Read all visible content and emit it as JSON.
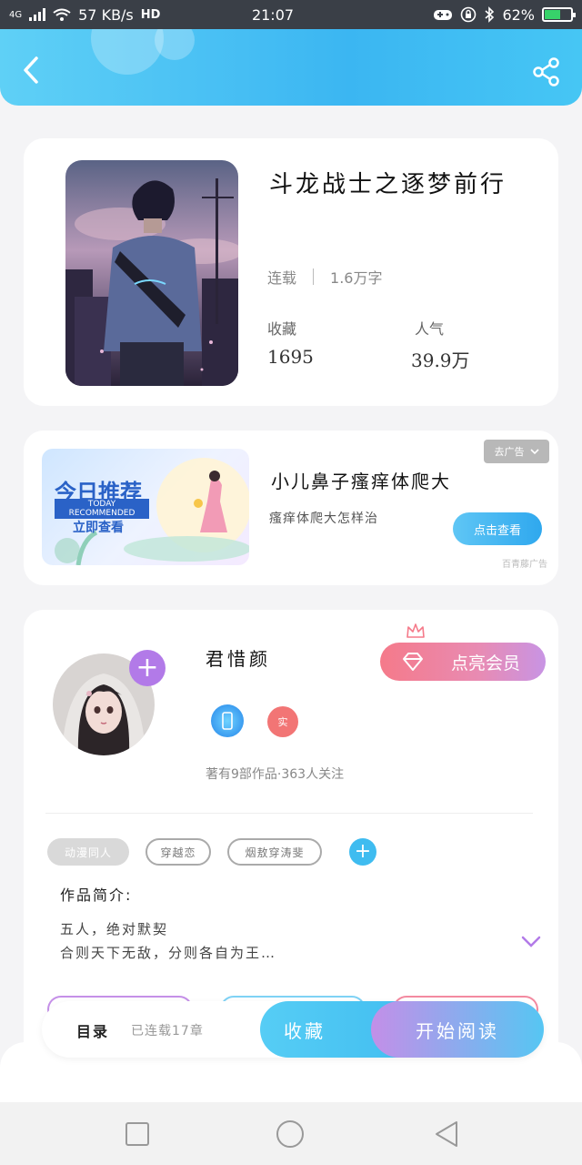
{
  "status": {
    "network": "4G",
    "speed": "57 KB/s",
    "hd": "HD",
    "time": "21:07",
    "battery": "62%",
    "battery_level": 0.62
  },
  "header": {
    "back_icon": "chevron-left-icon",
    "share_icon": "share-icon"
  },
  "book": {
    "title": "斗龙战士之逐梦前行",
    "status": "连载",
    "word_count": "1.6万字",
    "collect_label": "收藏",
    "collect_value": "1695",
    "popularity_label": "人气",
    "popularity_value": "39.9万"
  },
  "ad": {
    "banner_title": "今日推荐",
    "banner_en": "TODAY RECOMMENDED",
    "banner_cta": "立即查看",
    "title": "小儿鼻子瘙痒体爬大",
    "subtitle": "瘙痒体爬大怎样治",
    "close_label": "去广告",
    "cta_label": "点击查看",
    "source": "百青藤广告"
  },
  "author": {
    "name": "君惜颜",
    "follow_icon": "plus-icon",
    "badge_label": "实",
    "info": "著有9部作品·363人关注",
    "vip_label": "点亮会员",
    "tags": [
      "动漫同人",
      "穿越恋",
      "烟敖穿涛斐"
    ],
    "intro_label": "作品简介:",
    "intro_lines": [
      "五人，绝对默契",
      "合则天下无敌，分则各自为王…"
    ]
  },
  "bottom": {
    "toc_label": "目录",
    "toc_sub": "已连载17章",
    "collect_label": "收藏",
    "read_label": "开始阅读"
  },
  "colors": {
    "accent_blue": "#3fbcf0",
    "accent_purple": "#b27ae8",
    "vip_pink": "#f57a8a"
  }
}
